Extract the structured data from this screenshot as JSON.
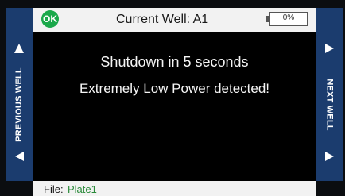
{
  "header": {
    "status_badge": "OK",
    "title": "Current Well: A1",
    "battery_level": "0%"
  },
  "left_panel": {
    "label": "PREVIOUS WELL"
  },
  "right_panel": {
    "label": "NEXT WELL"
  },
  "messages": {
    "line1": "Shutdown in 5 seconds",
    "line2": "Extremely Low Power detected!"
  },
  "footer": {
    "file_label": "File:",
    "file_name": "Plate1"
  },
  "colors": {
    "panel_blue": "#1b3c6e",
    "ok_green": "#1aa84a",
    "file_green": "#2a8a3a"
  },
  "icons": [
    "triangle-up-icon",
    "triangle-left-icon",
    "triangle-right-icon",
    "battery-icon"
  ]
}
